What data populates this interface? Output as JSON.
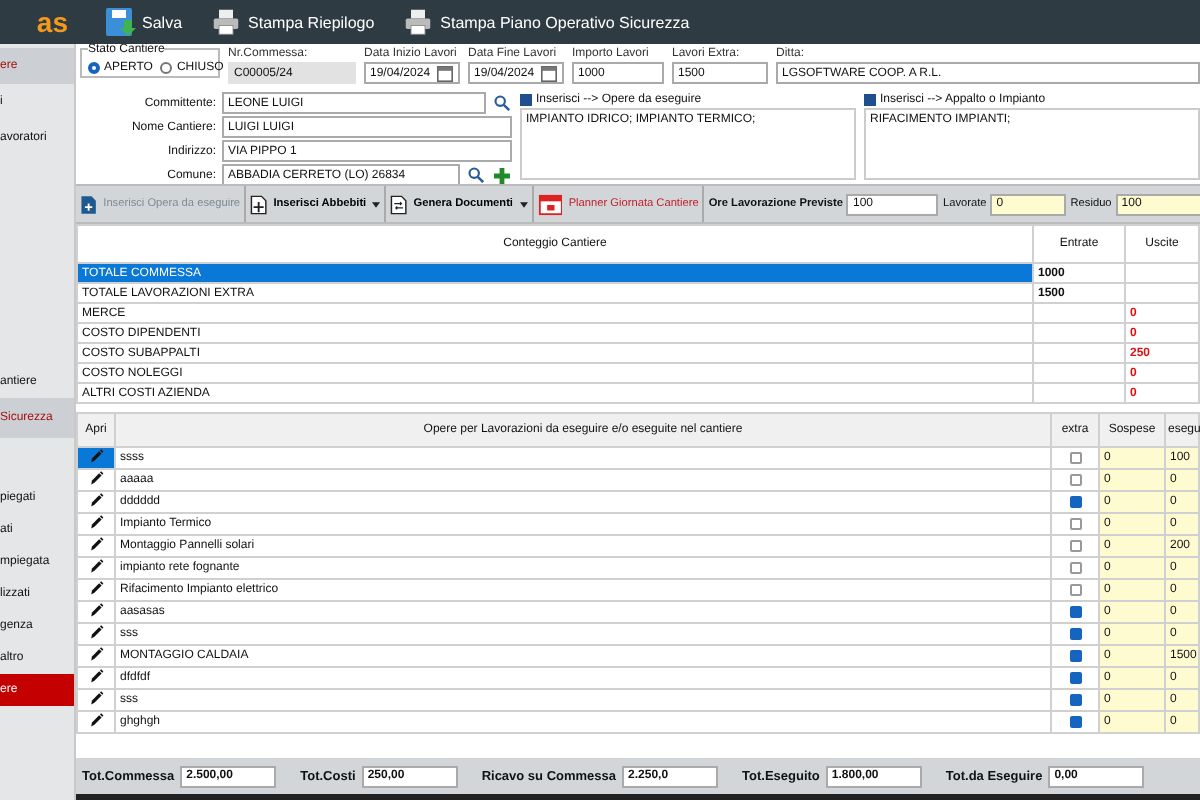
{
  "header": {
    "logo": "as",
    "buttons": [
      {
        "label": "Salva",
        "kind": "save"
      },
      {
        "label": "Stampa Riepilogo",
        "kind": "print"
      },
      {
        "label": "Stampa Piano Operativo Sicurezza",
        "kind": "print"
      }
    ]
  },
  "sidebar": {
    "groups": [
      [
        {
          "label": "ere",
          "kind": "section"
        },
        {
          "label": "i",
          "kind": "plain"
        },
        {
          "label": "avoratori",
          "kind": "plain"
        }
      ],
      [
        {
          "label": "antiere",
          "kind": "plain"
        },
        {
          "label": "Sicurezza",
          "kind": "section"
        }
      ],
      [
        {
          "label": "piegati",
          "kind": "plain"
        },
        {
          "label": "ati",
          "kind": "plain"
        },
        {
          "label": "mpiegata",
          "kind": "plain"
        },
        {
          "label": "lizzati",
          "kind": "plain"
        },
        {
          "label": "genza",
          "kind": "plain"
        },
        {
          "label": "altro",
          "kind": "plain"
        },
        {
          "label": "ere",
          "kind": "active"
        }
      ]
    ]
  },
  "form": {
    "stato": {
      "title": "Stato Cantiere",
      "options": [
        {
          "label": "APERTO",
          "selected": true
        },
        {
          "label": "CHIUSO",
          "selected": false
        }
      ]
    },
    "nr_commessa": {
      "label": "Nr.Commessa:",
      "value": "C00005/24"
    },
    "data_inizio": {
      "label": "Data Inizio Lavori",
      "value": "19/04/2024"
    },
    "data_fine": {
      "label": "Data Fine Lavori",
      "value": "19/04/2024"
    },
    "importo": {
      "label": "Importo Lavori",
      "value": "1000"
    },
    "extra": {
      "label": "Lavori Extra:",
      "value": "1500"
    },
    "ditta": {
      "label": "Ditta:",
      "value": "LGSOFTWARE COOP. A R.L."
    },
    "fields": [
      {
        "label": "Committente:",
        "value": "LEONE LUIGI",
        "kind": "search"
      },
      {
        "label": "Nome Cantiere:",
        "value": "LUIGI LUIGI",
        "kind": "plain"
      },
      {
        "label": "Indirizzo:",
        "value": "VIA PIPPO 1",
        "kind": "plain"
      },
      {
        "label": "Comune:",
        "value": "ABBADIA CERRETO (LO) 26834",
        "kind": "search_add"
      }
    ],
    "notes": [
      {
        "label": "Inserisci  --> Opere da eseguire",
        "value": "IMPIANTO IDRICO; IMPIANTO TERMICO;"
      },
      {
        "label": "Inserisci  --> Appalto o Impianto",
        "value": "RIFACIMENTO IMPIANTI;"
      }
    ]
  },
  "toolbar": {
    "buttons": [
      {
        "label": "Inserisci Opera da eseguire",
        "kind": "insert",
        "disabled": true,
        "dropdown": false
      },
      {
        "label": "Inserisci Abbebiti",
        "kind": "add",
        "disabled": false,
        "dropdown": true
      },
      {
        "label": "Genera Documenti",
        "kind": "doc",
        "disabled": false,
        "dropdown": true
      },
      {
        "label": "Planner Giornata Cantiere",
        "kind": "calendar",
        "disabled": false,
        "dropdown": false
      }
    ],
    "ore": {
      "label": "Ore Lavorazione Previste",
      "value": "100"
    },
    "lavorate": {
      "label": "Lavorate",
      "value": "0"
    },
    "residuo": {
      "label": "Residuo",
      "value": "100"
    }
  },
  "costs": {
    "columns": [
      "Conteggio Cantiere",
      "Entrate",
      "Uscite"
    ],
    "rows": [
      {
        "label": "TOTALE COMMESSA",
        "entrate": "1000",
        "uscite": "",
        "selected": true
      },
      {
        "label": "TOTALE  LAVORAZIONI EXTRA",
        "entrate": "1500",
        "uscite": "",
        "selected": false
      },
      {
        "label": "MERCE",
        "entrate": "",
        "uscite": "0",
        "selected": false
      },
      {
        "label": "COSTO DIPENDENTI",
        "entrate": "",
        "uscite": "0",
        "selected": false
      },
      {
        "label": "COSTO SUBAPPALTI",
        "entrate": "",
        "uscite": "250",
        "selected": false
      },
      {
        "label": "COSTO NOLEGGI",
        "entrate": "",
        "uscite": "0",
        "selected": false
      },
      {
        "label": "ALTRI COSTI AZIENDA",
        "entrate": "",
        "uscite": "0",
        "selected": false
      }
    ]
  },
  "works": {
    "columns": [
      "Apri",
      "Opere per Lavorazioni da eseguire e/o eseguite nel cantiere",
      "extra",
      "Sospese",
      "esegu"
    ],
    "rows": [
      {
        "name": "ssss",
        "extra": false,
        "sospese": "0",
        "eseguite": "100",
        "selected": true
      },
      {
        "name": "aaaaa",
        "extra": false,
        "sospese": "0",
        "eseguite": "0",
        "selected": false
      },
      {
        "name": "dddddd",
        "extra": true,
        "sospese": "0",
        "eseguite": "0",
        "selected": false
      },
      {
        "name": "Impianto Termico",
        "extra": false,
        "sospese": "0",
        "eseguite": "0",
        "selected": false
      },
      {
        "name": "Montaggio Pannelli solari",
        "extra": false,
        "sospese": "0",
        "eseguite": "200",
        "selected": false
      },
      {
        "name": "impianto rete fognante",
        "extra": false,
        "sospese": "0",
        "eseguite": "0",
        "selected": false
      },
      {
        "name": "Rifacimento Impianto elettrico",
        "extra": false,
        "sospese": "0",
        "eseguite": "0",
        "selected": false
      },
      {
        "name": "aasasas",
        "extra": true,
        "sospese": "0",
        "eseguite": "0",
        "selected": false
      },
      {
        "name": "sss",
        "extra": true,
        "sospese": "0",
        "eseguite": "0",
        "selected": false
      },
      {
        "name": "MONTAGGIO CALDAIA",
        "extra": true,
        "sospese": "0",
        "eseguite": "1500",
        "selected": false
      },
      {
        "name": "dfdfdf",
        "extra": true,
        "sospese": "0",
        "eseguite": "0",
        "selected": false
      },
      {
        "name": "sss",
        "extra": true,
        "sospese": "0",
        "eseguite": "0",
        "selected": false
      },
      {
        "name": "ghghgh",
        "extra": true,
        "sospese": "0",
        "eseguite": "0",
        "selected": false
      }
    ]
  },
  "totals": [
    {
      "label": "Tot.Commessa",
      "value": "2.500,00"
    },
    {
      "label": "Tot.Costi",
      "value": "250,00"
    },
    {
      "label": "Ricavo su Commessa",
      "value": "2.250,0"
    },
    {
      "label": "Tot.Eseguito",
      "value": "1.800,00"
    },
    {
      "label": "Tot.da Eseguire",
      "value": "0,00"
    }
  ]
}
